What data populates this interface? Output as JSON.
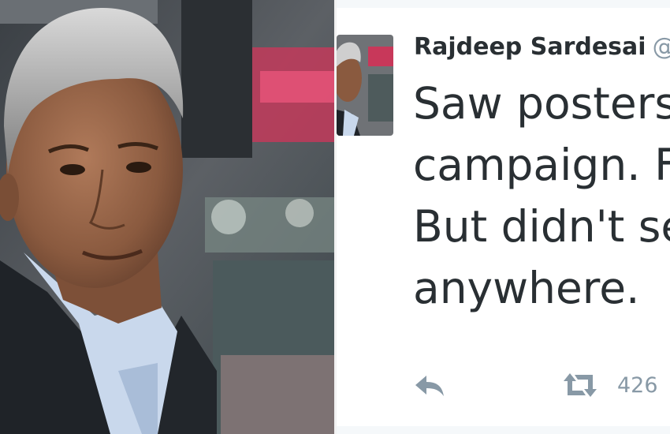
{
  "tweet": {
    "author_name": "Rajdeep Sardesai",
    "author_handle": "@s",
    "text_lines": [
      "Saw posters",
      "campaign. F",
      "But didn't se",
      "anywhere."
    ],
    "retweet_count": "426"
  },
  "icons": {
    "reply": "reply-arrow-icon",
    "retweet": "retweet-icon"
  },
  "colors": {
    "text": "#292f33",
    "muted": "#8899a6"
  }
}
